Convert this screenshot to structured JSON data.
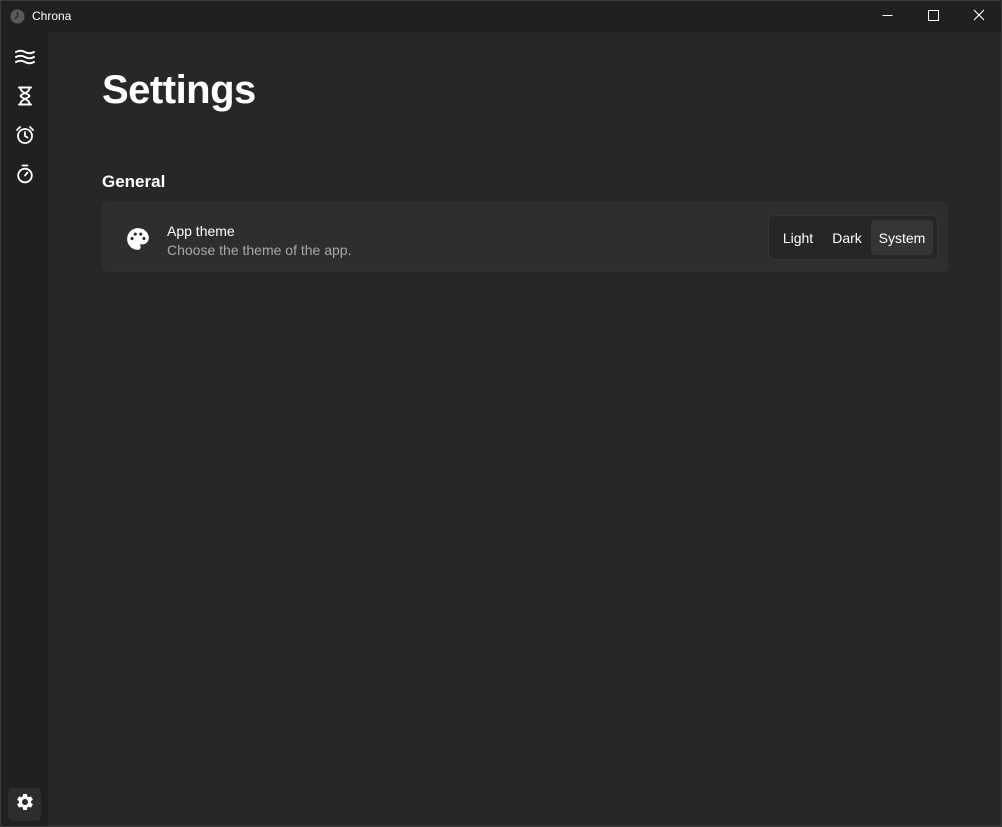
{
  "window": {
    "title": "Chrona",
    "controls": {
      "minimize_icon": "minimize-icon",
      "maximize_icon": "maximize-icon",
      "close_icon": "close-icon"
    }
  },
  "sidebar": {
    "items": [
      {
        "icon": "waves-icon"
      },
      {
        "icon": "hourglass-icon"
      },
      {
        "icon": "alarm-clock-icon"
      },
      {
        "icon": "stopwatch-icon"
      }
    ],
    "footer": {
      "icon": "gear-icon",
      "active": true
    }
  },
  "page": {
    "title": "Settings",
    "sections": [
      {
        "title": "General",
        "settings": [
          {
            "icon": "palette-icon",
            "label": "App theme",
            "description": "Choose the theme of the app.",
            "options": [
              "Light",
              "Dark",
              "System"
            ],
            "selected": "System"
          }
        ]
      }
    ]
  },
  "colors": {
    "background": "#272727",
    "sidebar": "#202020",
    "card": "#2e2e2e",
    "selected_segment": "#353535",
    "secondary_text": "#a8a8a8"
  }
}
